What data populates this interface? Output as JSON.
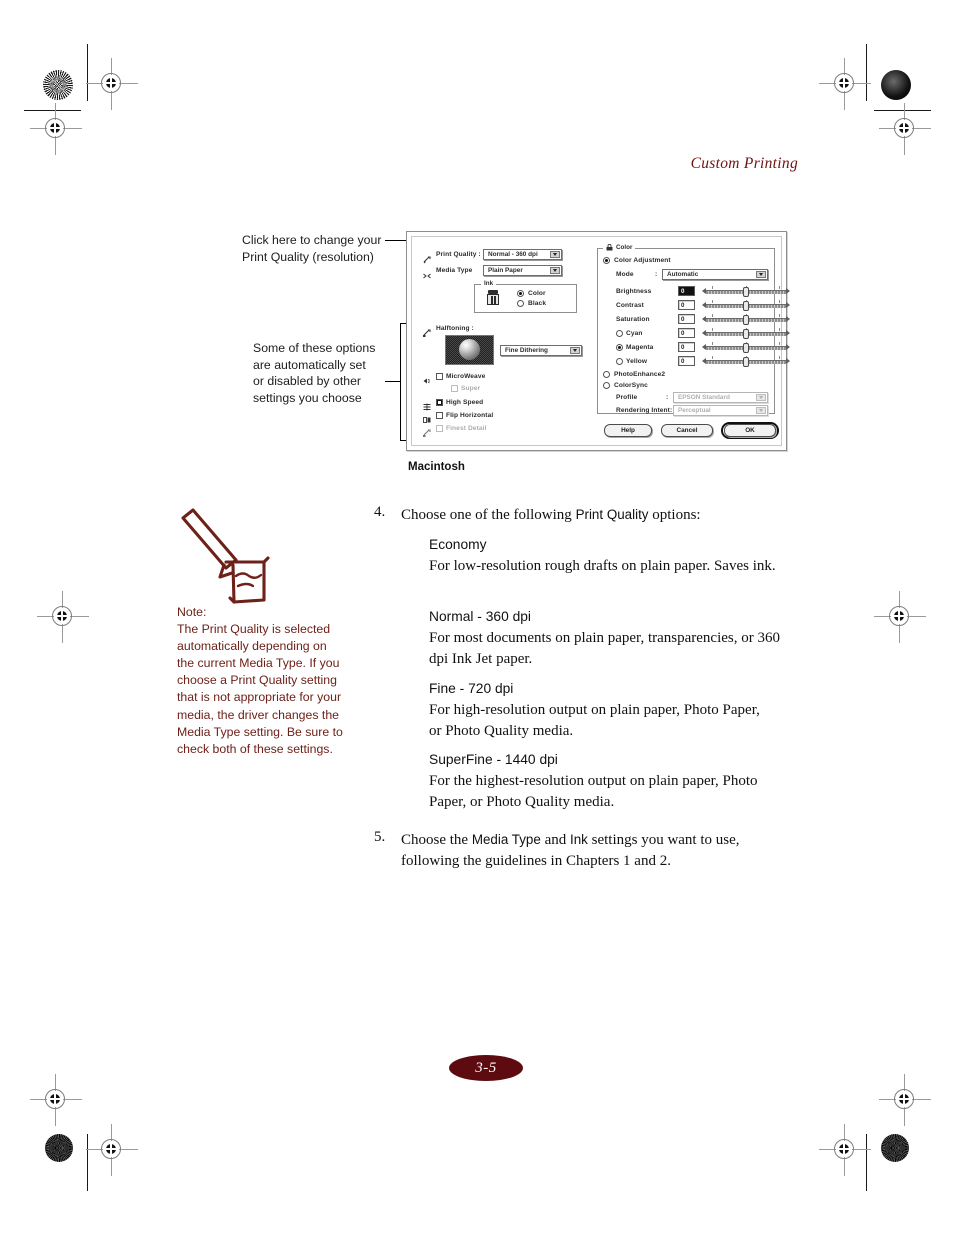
{
  "header": {
    "running_head": "Custom Printing"
  },
  "folio": {
    "page_number": "3-5"
  },
  "callouts": {
    "top": "Click here to change your\nPrint Quality (resolution)",
    "bottom": "Some of these options\nare automatically set\nor disabled by other\nsettings you choose"
  },
  "figure": {
    "caption": "Macintosh",
    "dialog": {
      "print_quality_label": "Print Quality :",
      "print_quality_value": "Normal - 360 dpi",
      "media_type_label": "Media Type",
      "media_type_value": "Plain Paper",
      "ink_group_label": "Ink",
      "ink_color_label": "Color",
      "ink_black_label": "Black",
      "halftoning_label": "Halftoning  :",
      "halftoning_value": "Fine Dithering",
      "microweave_label": "MicroWeave",
      "super_label": "Super",
      "high_speed_label": "High Speed",
      "flip_horizontal_label": "Flip Horizontal",
      "finest_detail_label": "Finest Detail",
      "color_group_label": "Color",
      "color_adjustment_label": "Color Adjustment",
      "mode_label": "Mode",
      "mode_colon": ":",
      "mode_value": "Automatic",
      "sliders": [
        {
          "name": "Brightness",
          "value": "0",
          "selected": true
        },
        {
          "name": "Contrast",
          "value": "0",
          "selected": false
        },
        {
          "name": "Saturation",
          "value": "0",
          "selected": false
        },
        {
          "name": "Cyan",
          "value": "0",
          "selected": false
        },
        {
          "name": "Magenta",
          "value": "0",
          "selected": false
        },
        {
          "name": "Yellow",
          "value": "0",
          "selected": false
        }
      ],
      "photoenhance_label": "PhotoEnhance2",
      "colorsync_label": "ColorSync",
      "profile_label": "Profile",
      "profile_colon": ":",
      "profile_value": "EPSON Standard",
      "rendering_intent_label": "Rendering Intent:",
      "rendering_intent_value": "Perceptual",
      "help_button": "Help",
      "cancel_button": "Cancel",
      "ok_button": "OK"
    }
  },
  "body": {
    "step4_num": "4.",
    "step4_text_a": "Choose one of the following ",
    "step4_text_b": "Print Quality",
    "step4_text_c": " options:",
    "options": [
      {
        "title": "Economy",
        "desc": "For low-resolution rough drafts on plain paper. Saves ink."
      },
      {
        "title": "Normal - 360 dpi",
        "desc": "For most documents on plain paper, transparencies, or 360 dpi Ink Jet paper."
      },
      {
        "title": "Fine - 720 dpi",
        "desc": "For high-resolution output on plain paper, Photo Paper, or Photo Quality media."
      },
      {
        "title": "SuperFine - 1440 dpi",
        "desc": "For the highest-resolution output on plain paper, Photo Paper, or Photo Quality media."
      }
    ],
    "step5_num": "5.",
    "step5_a": "Choose the ",
    "step5_b": "Media Type",
    "step5_c": " and ",
    "step5_d": "Ink",
    "step5_e": " settings you want to use, following the guidelines in Chapters 1 and 2."
  },
  "note": {
    "title": "Note:",
    "text": "The Print Quality is selected automatically depending on the current Media Type. If you choose a Print Quality setting that is not appropriate for your media, the driver changes the Media Type setting. Be sure to check both of these settings."
  },
  "colors": {
    "accent": "#6e1410",
    "note": "#6e2118",
    "folio": "#5d0b10"
  }
}
